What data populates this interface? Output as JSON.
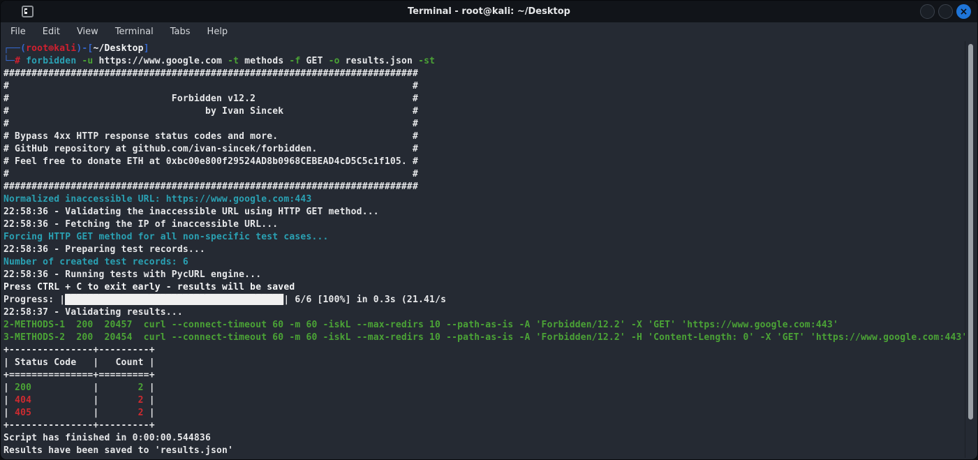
{
  "window": {
    "title": "Terminal - root@kali: ~/Desktop",
    "controls": {
      "close_glyph": "×"
    }
  },
  "menu": {
    "items": [
      "File",
      "Edit",
      "View",
      "Terminal",
      "Tabs",
      "Help"
    ]
  },
  "colors": {
    "bg": "#252A33",
    "titlebar": "#111419",
    "fg": "#E7E8EA",
    "fgb": "#F5F6F7",
    "cyan": "#2AA1B3",
    "green": "#4BA336",
    "red": "#CE2B30",
    "pred": "#D02030",
    "blue": "#3566C9",
    "bar": "#F0F0F0",
    "close": "#1F75D8",
    "thumb": "#9AA0A6"
  },
  "terminal": {
    "lines": [
      [
        [
          "┌──(",
          "blue"
        ],
        [
          "root㉿kali",
          "pred"
        ],
        [
          ")-[",
          "blue"
        ],
        [
          "~/Desktop",
          "fgb"
        ],
        [
          "]",
          "blue"
        ]
      ],
      [
        [
          "└─",
          "blue"
        ],
        [
          "#",
          "pred"
        ],
        [
          " ",
          "fg"
        ],
        [
          "forbidden",
          "cyan"
        ],
        [
          " ",
          "fg"
        ],
        [
          "-u",
          "green"
        ],
        [
          " https://www.google.com ",
          "fg"
        ],
        [
          "-t",
          "green"
        ],
        [
          " methods ",
          "fg"
        ],
        [
          "-f",
          "green"
        ],
        [
          " GET ",
          "fg"
        ],
        [
          "-o",
          "green"
        ],
        [
          " results.json ",
          "fg"
        ],
        [
          "-st",
          "green"
        ]
      ],
      [
        [
          "##########################################################################",
          "fg"
        ]
      ],
      [
        [
          "#                                                                        #",
          "fg"
        ]
      ],
      [
        [
          "#                             Forbidden v12.2                            #",
          "fg"
        ]
      ],
      [
        [
          "#                                   by Ivan Sincek                       #",
          "fg"
        ]
      ],
      [
        [
          "#                                                                        #",
          "fg"
        ]
      ],
      [
        [
          "# Bypass 4xx HTTP response status codes and more.                        #",
          "fg"
        ]
      ],
      [
        [
          "# GitHub repository at github.com/ivan-sincek/forbidden.                 #",
          "fg"
        ]
      ],
      [
        [
          "# Feel free to donate ETH at 0xbc00e800f29524AD8b0968CEBEAD4cD5C5c1f105. #",
          "fg"
        ]
      ],
      [
        [
          "#                                                                        #",
          "fg"
        ]
      ],
      [
        [
          "##########################################################################",
          "fg"
        ]
      ],
      [
        [
          "Normalized inaccessible URL: https://www.google.com:443",
          "cyan"
        ]
      ],
      [
        [
          "22:58:36 - Validating the inaccessible URL using HTTP GET method...",
          "fg"
        ]
      ],
      [
        [
          "22:58:36 - Fetching the IP of inaccessible URL...",
          "fg"
        ]
      ],
      [
        [
          "Forcing HTTP GET method for all non-specific test cases...",
          "cyan"
        ]
      ],
      [
        [
          "22:58:36 - Preparing test records...",
          "fg"
        ]
      ],
      [
        [
          "Number of created test records: 6",
          "cyan"
        ]
      ],
      [
        [
          "22:58:36 - Running tests with PycURL engine...",
          "fg"
        ]
      ],
      [
        [
          "Press CTRL + C to exit early - results will be saved",
          "fgb"
        ]
      ],
      [
        [
          "Progress: |",
          "fg"
        ],
        [
          "███████████████████████████████████████",
          "bar"
        ],
        [
          "| 6/6 [100%] in 0.3s (21.41/s",
          "fg"
        ]
      ],
      [
        [
          "22:58:37 - Validating results...",
          "fg"
        ]
      ],
      [
        [
          "2-METHODS-1  200  20457  curl --connect-timeout 60 -m 60 -iskL --max-redirs 10 --path-as-is -A 'Forbidden/12.2' -X 'GET' 'https://www.google.com:443'",
          "green"
        ]
      ],
      [
        [
          "3-METHODS-2  200  20454  curl --connect-timeout 60 -m 60 -iskL --max-redirs 10 --path-as-is -A 'Forbidden/12.2' -H 'Content-Length: 0' -X 'GET' 'https://www.google.com:443'",
          "green"
        ]
      ],
      [
        [
          "+---------------+---------+",
          "fg"
        ]
      ],
      [
        [
          "| Status Code   |   Count |",
          "fg"
        ]
      ],
      [
        [
          "+===============+=========+",
          "fg"
        ]
      ],
      [
        [
          "| ",
          "fg"
        ],
        [
          "200",
          "green"
        ],
        [
          "           ",
          "fg"
        ],
        [
          "|",
          "fg"
        ],
        [
          "       ",
          "fg"
        ],
        [
          "2",
          "green"
        ],
        [
          " |",
          "fg"
        ]
      ],
      [
        [
          "| ",
          "fg"
        ],
        [
          "404",
          "red"
        ],
        [
          "           ",
          "fg"
        ],
        [
          "|",
          "fg"
        ],
        [
          "       ",
          "fg"
        ],
        [
          "2",
          "red"
        ],
        [
          " |",
          "fg"
        ]
      ],
      [
        [
          "| ",
          "fg"
        ],
        [
          "405",
          "red"
        ],
        [
          "           ",
          "fg"
        ],
        [
          "|",
          "fg"
        ],
        [
          "       ",
          "fg"
        ],
        [
          "2",
          "red"
        ],
        [
          " |",
          "fg"
        ]
      ],
      [
        [
          "+---------------+---------+",
          "fg"
        ]
      ],
      [
        [
          "Script has finished in 0:00:00.544836",
          "fg"
        ]
      ],
      [
        [
          "Results have been saved to 'results.json'",
          "fg"
        ]
      ]
    ]
  }
}
